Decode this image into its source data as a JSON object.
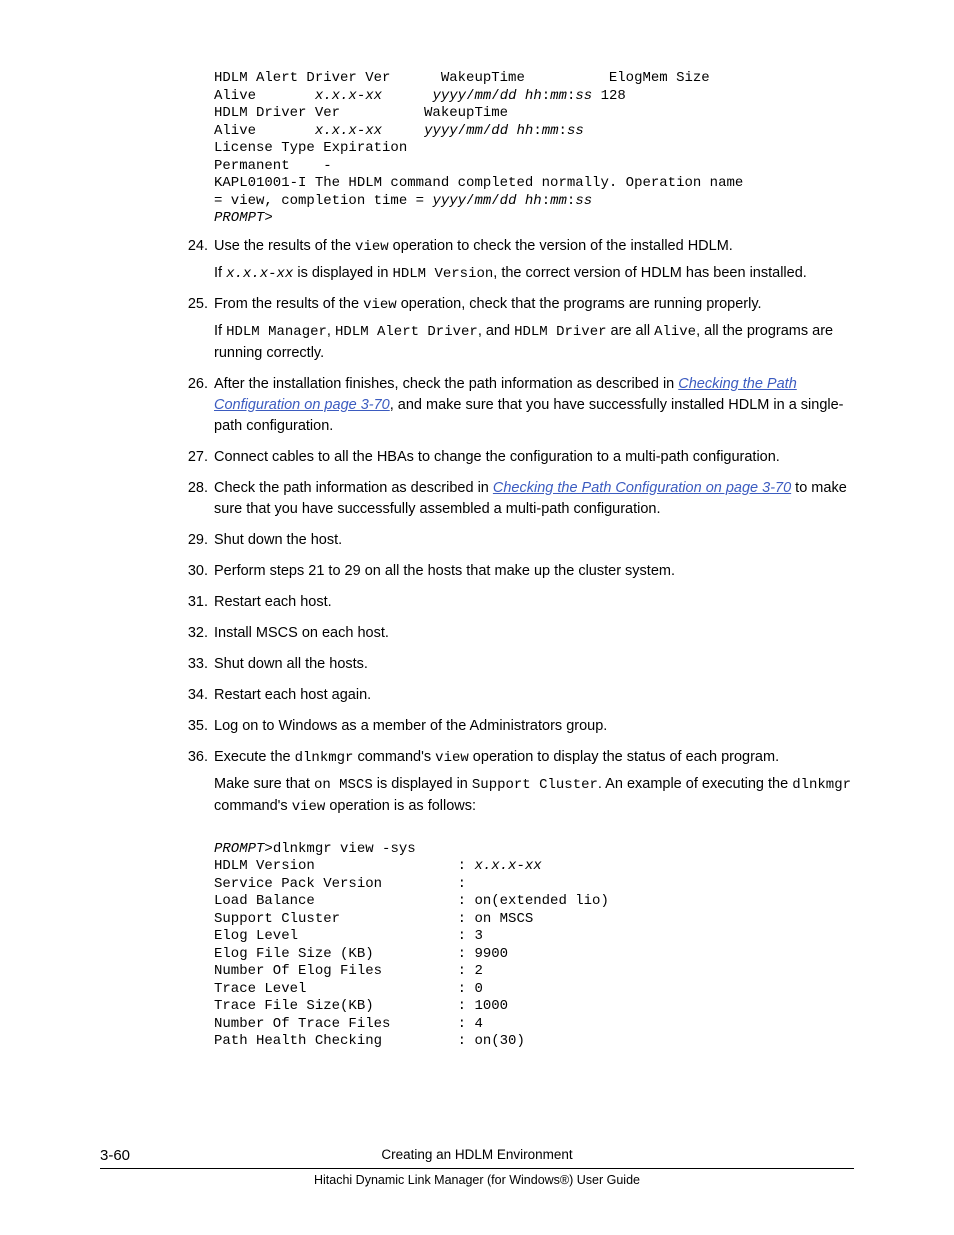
{
  "code_block_1": "HDLM Alert Driver Ver      WakeupTime          ElogMem Size\nAlive       <em>x.x.x-xx</em>      <em>yyyy</em>/<em>mm</em>/<em>dd</em> <em>hh</em>:<em>mm</em>:<em>ss</em> 128\nHDLM Driver Ver          WakeupTime\nAlive       <em>x.x.x-xx</em>     <em>yyyy</em>/<em>mm</em>/<em>dd</em> <em>hh</em>:<em>mm</em>:<em>ss</em>\nLicense Type Expiration\nPermanent    -\nKAPL01001-I The HDLM command completed normally. Operation name \n= view, completion time = <em>yyyy</em>/<em>mm</em>/<em>dd</em> <em>hh</em>:<em>mm</em>:<em>ss</em>\n<em>PROMPT</em>>",
  "steps": {
    "s24": {
      "num": "24.",
      "body_parts": [
        "Use the results of the ",
        "view",
        " operation to check the version of the installed HDLM."
      ],
      "sub_parts": [
        "If ",
        "x.x.x-xx",
        " is displayed in ",
        "HDLM Version",
        ", the correct version of HDLM has been installed."
      ]
    },
    "s25": {
      "num": "25.",
      "body_parts": [
        "From the results of the ",
        "view",
        " operation, check that the programs are running properly."
      ],
      "sub_parts": [
        "If ",
        "HDLM Manager",
        ", ",
        "HDLM Alert Driver",
        ", and ",
        "HDLM Driver",
        " are all ",
        "Alive",
        ", all the programs are running correctly."
      ]
    },
    "s26": {
      "num": "26.",
      "pre_link": "After the installation finishes, check the path information as described in ",
      "link": "Checking the Path Configuration on page 3-70",
      "post_link": ", and make sure that you have successfully installed HDLM in a single-path configuration."
    },
    "s27": {
      "num": "27.",
      "text": "Connect cables to all the HBAs to change the configuration to a multi-path configuration."
    },
    "s28": {
      "num": "28.",
      "pre_link": "Check the path information as described in ",
      "link": "Checking the Path Configuration on page 3-70",
      "post_link": " to make sure that you have successfully assembled a multi-path configuration."
    },
    "s29": {
      "num": "29.",
      "text": "Shut down the host."
    },
    "s30": {
      "num": "30.",
      "text": "Perform steps 21 to 29 on all the hosts that make up the cluster system."
    },
    "s31": {
      "num": "31.",
      "text": "Restart each host."
    },
    "s32": {
      "num": "32.",
      "text": "Install MSCS on each host."
    },
    "s33": {
      "num": "33.",
      "text": "Shut down all the hosts."
    },
    "s34": {
      "num": "34.",
      "text": "Restart each host again."
    },
    "s35": {
      "num": "35.",
      "text": "Log on to Windows as a member of the Administrators group."
    },
    "s36": {
      "num": "36.",
      "body_parts": [
        "Execute the ",
        "dlnkmgr",
        " command's ",
        "view",
        " operation to display the status of each program."
      ],
      "sub_parts": [
        "Make sure that ",
        "on MSCS",
        " is displayed in ",
        "Support Cluster",
        ". An example of executing the ",
        "dlnkmgr",
        " command's ",
        "view",
        " operation is as follows:"
      ]
    }
  },
  "code_block_2": "<em>PROMPT</em>>dlnkmgr view -sys\nHDLM Version                 : <em>x.x.x-xx</em>\nService Pack Version         :\nLoad Balance                 : on(extended lio)\nSupport Cluster              : on MSCS\nElog Level                   : 3\nElog File Size (KB)          : 9900\nNumber Of Elog Files         : 2\nTrace Level                  : 0\nTrace File Size(KB)          : 1000\nNumber Of Trace Files        : 4\nPath Health Checking         : on(30)",
  "footer": {
    "page": "3-60",
    "title": "Creating an HDLM Environment",
    "sub": "Hitachi Dynamic Link Manager (for Windows®) User Guide"
  }
}
